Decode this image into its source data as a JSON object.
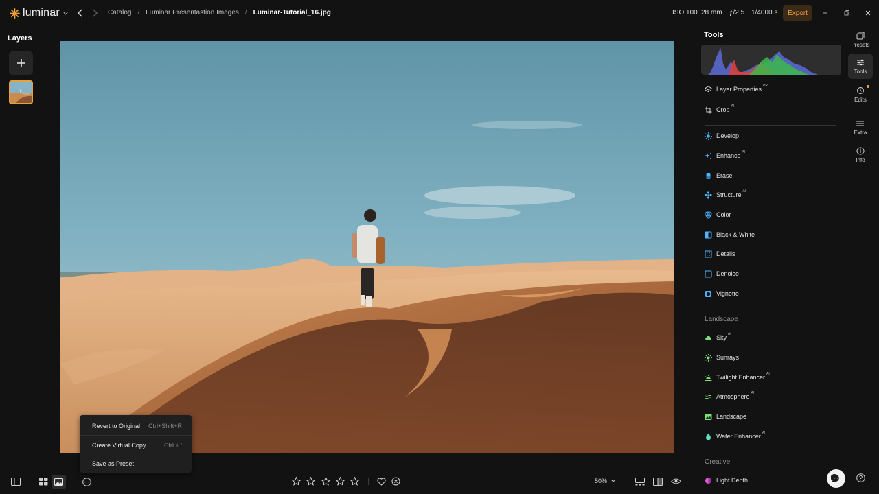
{
  "app": {
    "name": "luminar"
  },
  "breadcrumb": {
    "items": [
      "Catalog",
      "Luminar Presentastion Images"
    ],
    "current": "Luminar-Tutorial_16.jpg"
  },
  "exif": {
    "iso": "ISO 100",
    "focal": "28 mm",
    "aperture": "ƒ/2.5",
    "shutter": "1/4000 s"
  },
  "toolbar": {
    "export_label": "Export"
  },
  "layers": {
    "title": "Layers"
  },
  "tools": {
    "title": "Tools",
    "items": [
      {
        "label": "Layer Properties",
        "badge": "PRO",
        "icon": "layers-icon"
      },
      {
        "label": "Crop",
        "badge": "AI",
        "icon": "crop-icon"
      },
      {
        "label": "Develop",
        "badge": "",
        "icon": "sun-icon",
        "color": "#4db3ff"
      },
      {
        "label": "Enhance",
        "badge": "AI",
        "icon": "sparkle-icon",
        "color": "#4db3ff"
      },
      {
        "label": "Erase",
        "badge": "",
        "icon": "eraser-icon",
        "color": "#4db3ff"
      },
      {
        "label": "Structure",
        "badge": "AI",
        "icon": "structure-icon",
        "color": "#4db3ff"
      },
      {
        "label": "Color",
        "badge": "",
        "icon": "color-icon",
        "color": "#4db3ff"
      },
      {
        "label": "Black & White",
        "badge": "",
        "icon": "bw-icon",
        "color": "#4db3ff"
      },
      {
        "label": "Details",
        "badge": "",
        "icon": "details-icon",
        "color": "#4db3ff"
      },
      {
        "label": "Denoise",
        "badge": "",
        "icon": "denoise-icon",
        "color": "#4db3ff"
      },
      {
        "label": "Vignette",
        "badge": "",
        "icon": "vignette-icon",
        "color": "#4db3ff"
      }
    ],
    "landscape_title": "Landscape",
    "landscape": [
      {
        "label": "Sky",
        "badge": "AI",
        "icon": "cloud-icon",
        "color": "#7ee07a"
      },
      {
        "label": "Sunrays",
        "badge": "",
        "icon": "sunrays-icon",
        "color": "#7ee07a"
      },
      {
        "label": "Twilight Enhancer",
        "badge": "AI",
        "icon": "twilight-icon",
        "color": "#7ee07a"
      },
      {
        "label": "Atmosphere",
        "badge": "AI",
        "icon": "atmosphere-icon",
        "color": "#7ee07a"
      },
      {
        "label": "Landscape",
        "badge": "",
        "icon": "landscape-icon",
        "color": "#7ee07a"
      },
      {
        "label": "Water Enhancer",
        "badge": "AI",
        "icon": "water-drop-icon",
        "color": "#5fe0c0"
      }
    ],
    "creative_title": "Creative",
    "creative": [
      {
        "label": "Light Depth",
        "badge": "",
        "icon": "light-depth-icon",
        "color": "#e05bd8"
      }
    ]
  },
  "rail": {
    "presets": "Presets",
    "tools": "Tools",
    "edits": "Edits",
    "extra": "Extra",
    "info": "Info"
  },
  "context_menu": {
    "items": [
      {
        "label": "Revert to Original",
        "shortcut": "Ctrl+Shift+R"
      },
      {
        "label": "Create Virtual Copy",
        "shortcut": "Ctrl + '"
      },
      {
        "label": "Save as Preset",
        "shortcut": ""
      }
    ]
  },
  "bottom": {
    "zoom": "50%",
    "rating_stars": 0
  },
  "colors": {
    "accent": "#f0a14a",
    "export_bg": "#3a2a16",
    "tool_icon": "#4db3ff"
  }
}
